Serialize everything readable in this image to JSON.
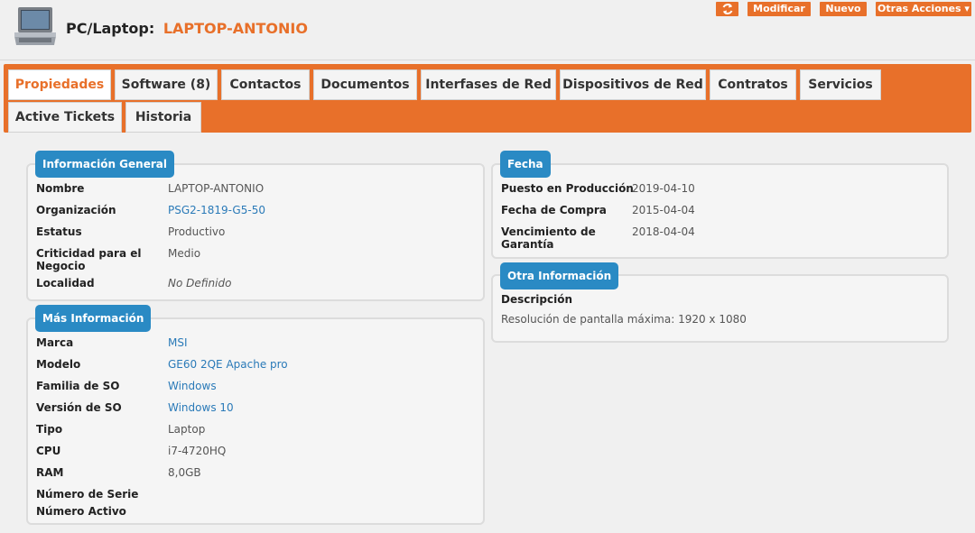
{
  "header": {
    "title_prefix": "PC/Laptop:",
    "title_name": "LAPTOP-ANTONIO",
    "icon": "laptop-icon"
  },
  "actions": {
    "refresh_icon": "refresh-icon",
    "modificar": "Modificar",
    "nuevo": "Nuevo",
    "otras": "Otras Acciones ▾"
  },
  "tabs": [
    {
      "label": "Propiedades"
    },
    {
      "label": "Software (8)"
    },
    {
      "label": "Contactos"
    },
    {
      "label": "Documentos"
    },
    {
      "label": "Interfases de Red"
    },
    {
      "label": "Dispositivos de Red"
    },
    {
      "label": "Contratos"
    },
    {
      "label": "Servicios"
    },
    {
      "label": "Active Tickets"
    },
    {
      "label": "Historia"
    }
  ],
  "general": {
    "legend": "Información General",
    "rows": [
      {
        "label": "Nombre",
        "value": "LAPTOP-ANTONIO"
      },
      {
        "label": "Organización",
        "value": "PSG2-1819-G5-50"
      },
      {
        "label": "Estatus",
        "value": "Productivo"
      },
      {
        "label": "Criticidad para el\nNegocio",
        "value": "Medio"
      },
      {
        "label": "Localidad",
        "value": "No Definido"
      }
    ]
  },
  "mas": {
    "legend": "Más Información",
    "rows": [
      {
        "label": "Marca",
        "value": "MSI"
      },
      {
        "label": "Modelo",
        "value": "GE60 2QE Apache pro"
      },
      {
        "label": "Familia de SO",
        "value": "Windows"
      },
      {
        "label": "Versión de SO",
        "value": "Windows 10"
      },
      {
        "label": "Tipo",
        "value": "Laptop"
      },
      {
        "label": "CPU",
        "value": "i7-4720HQ"
      },
      {
        "label": "RAM",
        "value": "8,0GB"
      },
      {
        "label": "Número de Serie",
        "value": ""
      },
      {
        "label": "Número Activo",
        "value": ""
      }
    ]
  },
  "fecha": {
    "legend": "Fecha",
    "rows": [
      {
        "label": "Puesto en Producción",
        "value": "2019-04-10"
      },
      {
        "label": "Fecha de Compra",
        "value": "2015-04-04"
      },
      {
        "label": "Vencimiento de\nGarantía",
        "value": "2018-04-04"
      }
    ]
  },
  "otra": {
    "legend": "Otra Información",
    "desc_label": "Descripción",
    "desc_value": "Resolución de pantalla máxima: 1920 x 1080"
  },
  "colors": {
    "accent": "#e8702a",
    "legend": "#2a8ac4",
    "link": "#2a7ab8"
  }
}
